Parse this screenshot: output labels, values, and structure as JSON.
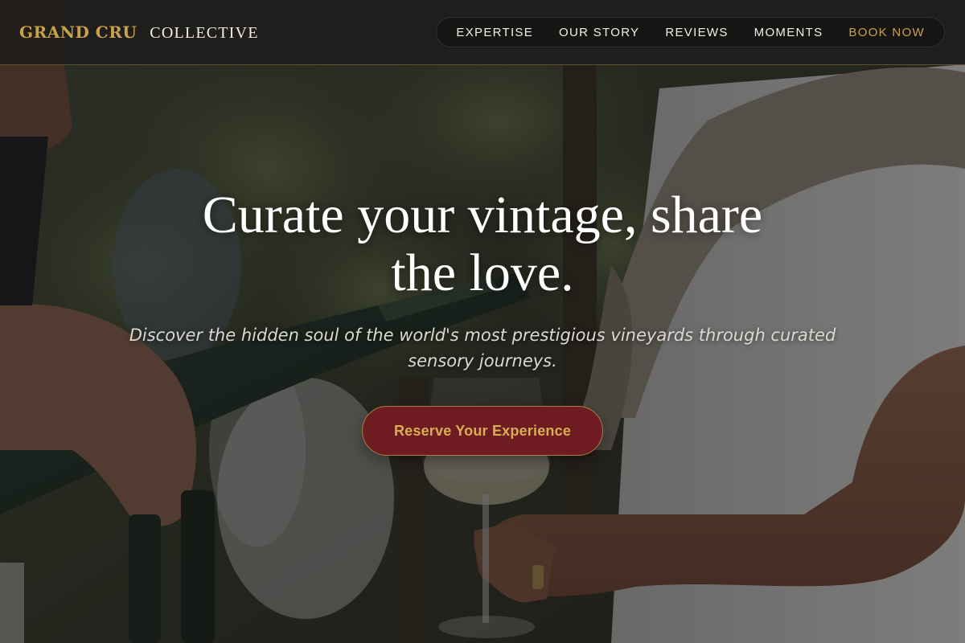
{
  "brand": {
    "name_primary": "GRAND CRU",
    "name_secondary": "COLLECTIVE"
  },
  "nav": {
    "items": [
      {
        "label": "EXPERTISE"
      },
      {
        "label": "OUR STORY"
      },
      {
        "label": "REVIEWS"
      },
      {
        "label": "MOMENTS"
      },
      {
        "label": "BOOK NOW"
      }
    ]
  },
  "hero": {
    "headline_line1": "Curate your vintage, share",
    "headline_line2": "the love.",
    "subheadline": "Discover the hidden soul of the world's most prestigious vineyards through curated sensory journeys.",
    "cta_label": "Reserve Your Experience",
    "background_image": "wine-tasting-photo"
  },
  "colors": {
    "accent_gold": "#c8a24a",
    "cta_burgundy": "#6e1b22",
    "header_bg": "#201e1c",
    "text_light": "#f2efe8"
  }
}
